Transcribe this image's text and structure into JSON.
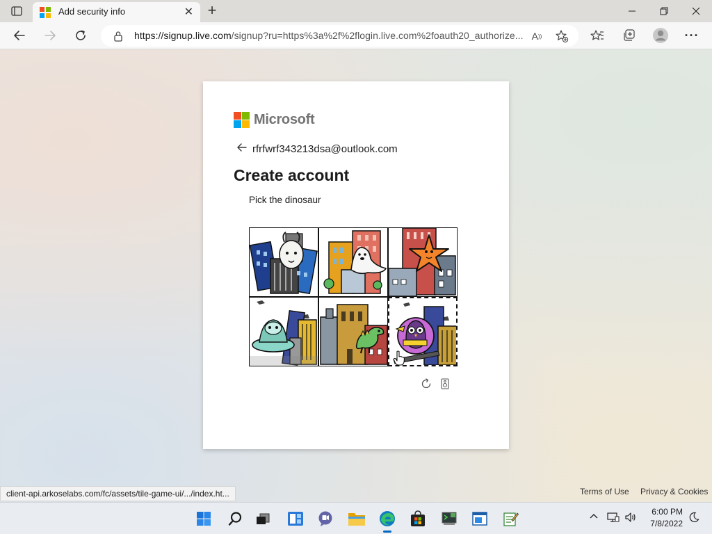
{
  "browser": {
    "tab_title": "Add security info",
    "tab_close": "✕",
    "new_tab": "+",
    "url_host": "https://signup.live.com",
    "url_rest": "/signup?ru=https%3a%2f%2flogin.live.com%2foauth20_authorize....",
    "window_controls": [
      "minimize",
      "restore",
      "close"
    ]
  },
  "card": {
    "brand": "Microsoft",
    "identity_email": "rfrfwrf343213dsa@outlook.com",
    "heading": "Create account",
    "prompt": "Pick the dinosaur",
    "tiles": [
      {
        "icon": "goat-tile"
      },
      {
        "icon": "seal-tile"
      },
      {
        "icon": "starfish-tile"
      },
      {
        "icon": "alien-tile"
      },
      {
        "icon": "dinosaur-tile"
      },
      {
        "icon": "owl-tile"
      }
    ],
    "reload_icon": "refresh-icon",
    "audio_icon": "audio-challenge-icon"
  },
  "status_bar": {
    "hover_url": "client-api.arkoselabs.com/fc/assets/tile-game-ui/.../index.ht..."
  },
  "footer": {
    "terms": "Terms of Use",
    "privacy": "Privacy & Cookies"
  },
  "taskbar": {
    "time": "6:00 PM",
    "date": "7/8/2022"
  },
  "colors": {
    "ms_red": "#f25022",
    "ms_green": "#7fba00",
    "ms_blue": "#00a4ef",
    "ms_yellow": "#ffb900",
    "accent": "#0067c0"
  }
}
